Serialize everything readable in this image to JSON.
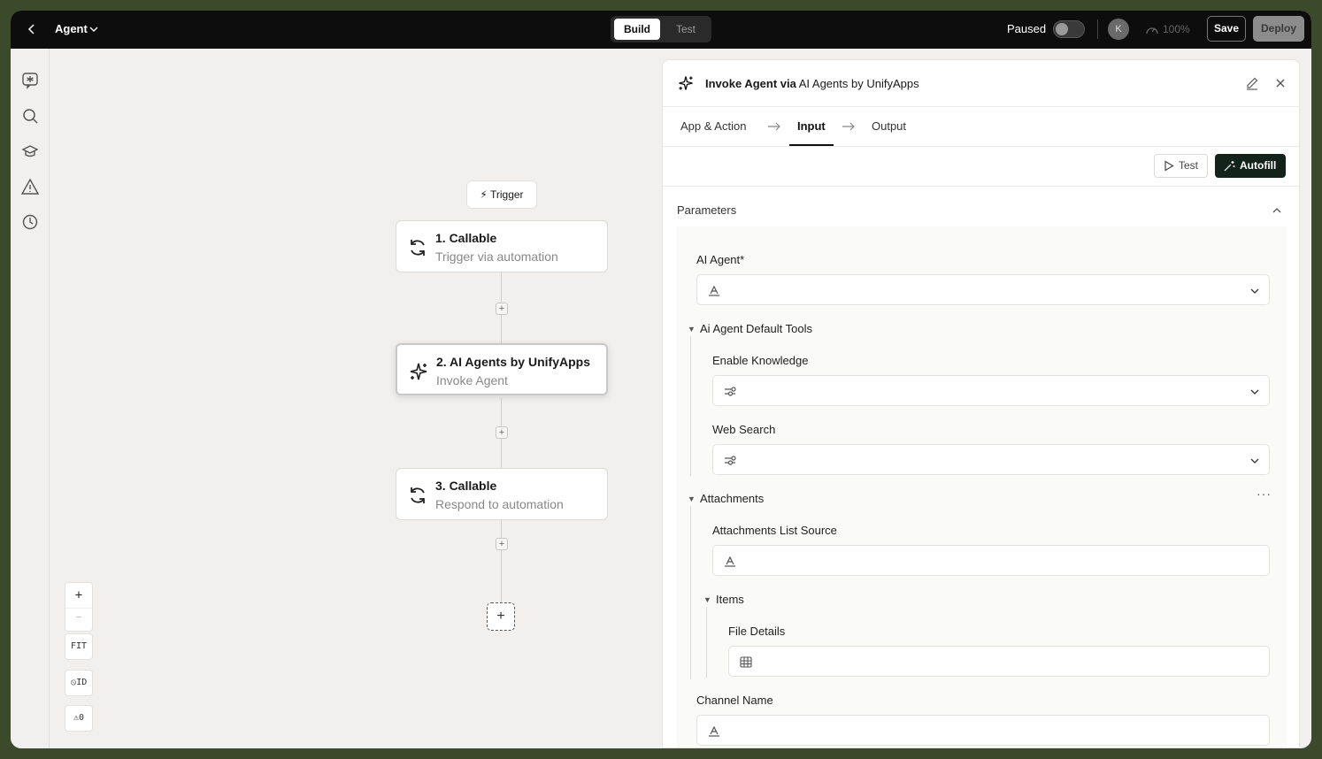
{
  "topbar": {
    "agent_title": "Agent",
    "mode_build": "Build",
    "mode_test": "Test",
    "paused_label": "Paused",
    "avatar_initial": "K",
    "zoom_level": "100%",
    "save_label": "Save",
    "deploy_label": "Deploy"
  },
  "rail": {
    "icons": [
      "agent-chat-icon",
      "search-icon",
      "graduation-cap-icon",
      "warning-icon",
      "history-icon"
    ]
  },
  "canvas": {
    "trigger_label": "Trigger",
    "nodes": [
      {
        "title": "1. Callable",
        "subtitle": "Trigger via automation",
        "icon": "sync-icon"
      },
      {
        "title": "2. AI Agents by UnifyApps",
        "subtitle": "Invoke Agent",
        "icon": "sparkles-icon"
      },
      {
        "title": "3. Callable",
        "subtitle": "Respond to automation",
        "icon": "sync-icon"
      }
    ],
    "zoom_controls": {
      "zoom_in": "+",
      "zoom_out": "—",
      "fit": "FIT",
      "id_toggle": "⦸ID",
      "warnings": "⚠0"
    }
  },
  "panel": {
    "title_bold": "Invoke Agent via",
    "title_rest": " AI Agents by UnifyApps",
    "tabs": [
      "App & Action",
      "Input",
      "Output"
    ],
    "active_tab": "Input",
    "test_label": "Test",
    "autofill_label": "Autofill",
    "parameters_label": "Parameters",
    "fields": {
      "ai_agent_label": "AI Agent*",
      "default_tools_label": "Ai Agent Default Tools",
      "enable_knowledge_label": "Enable Knowledge",
      "web_search_label": "Web Search",
      "attachments_label": "Attachments",
      "attachments_list_source_label": "Attachments List Source",
      "items_label": "Items",
      "file_details_label": "File Details",
      "channel_name_label": "Channel Name"
    }
  }
}
